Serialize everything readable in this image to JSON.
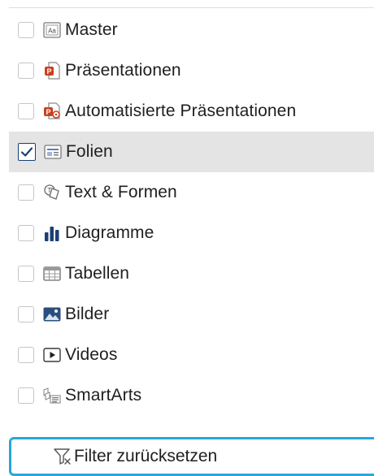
{
  "colors": {
    "selected_row_bg": "#e4e4e4",
    "checkbox_check": "#1b3f73",
    "reset_border": "#2aa6db",
    "powerpoint_orange": "#c8421f"
  },
  "filters": {
    "items": [
      {
        "label": "Master",
        "icon": "master-slide-icon",
        "checked": false
      },
      {
        "label": "Präsentationen",
        "icon": "presentation-file-icon",
        "checked": false
      },
      {
        "label": "Automatisierte Präsentationen",
        "icon": "automated-presentation-icon",
        "checked": false
      },
      {
        "label": "Folien",
        "icon": "slide-icon",
        "checked": true
      },
      {
        "label": "Text & Formen",
        "icon": "text-shapes-icon",
        "checked": false
      },
      {
        "label": "Diagramme",
        "icon": "bar-chart-icon",
        "checked": false
      },
      {
        "label": "Tabellen",
        "icon": "table-icon",
        "checked": false
      },
      {
        "label": "Bilder",
        "icon": "image-icon",
        "checked": false
      },
      {
        "label": "Videos",
        "icon": "video-icon",
        "checked": false
      },
      {
        "label": "SmartArts",
        "icon": "smartart-icon",
        "checked": false
      }
    ]
  },
  "reset": {
    "label": "Filter zurücksetzen",
    "icon": "filter-reset-icon"
  }
}
